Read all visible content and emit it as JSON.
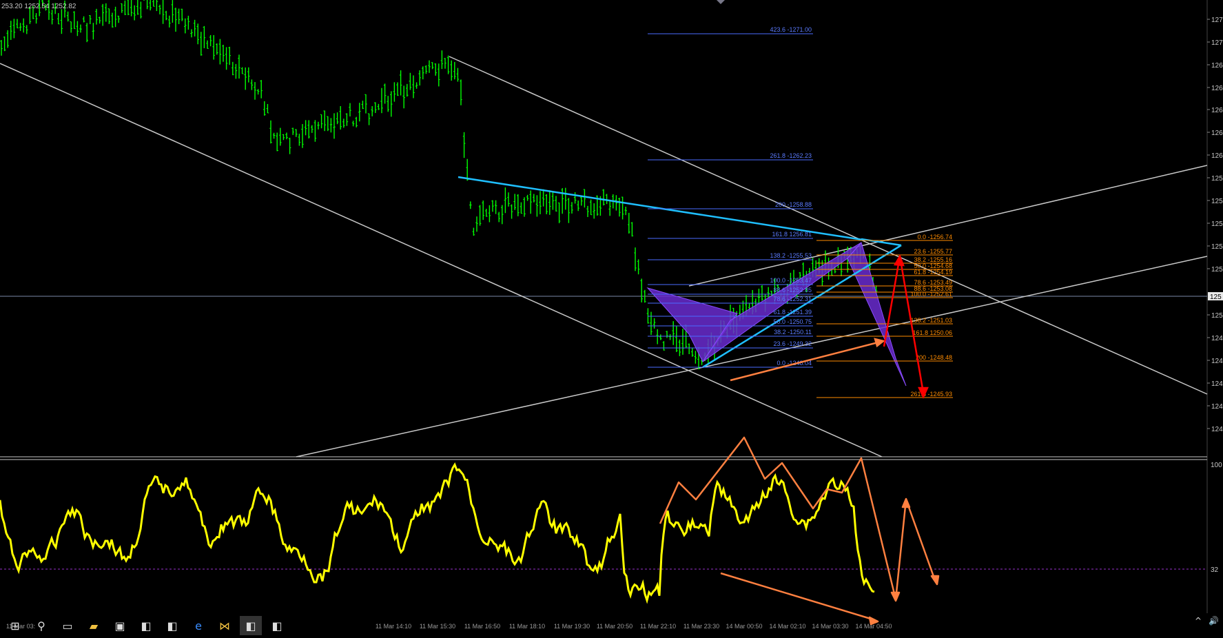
{
  "ohlc_header": "253.20 1252.54 1252.82",
  "price_axis": [
    "127",
    "127",
    "126",
    "126",
    "126",
    "126",
    "126",
    "125",
    "125",
    "125",
    "125",
    "125",
    "125",
    "124",
    "124",
    "124",
    "124",
    "124"
  ],
  "current_price_tag": "125",
  "indicator_axis": {
    "top": "100",
    "mid": "32"
  },
  "fib_blue": [
    "423.6 -1271.00",
    "261.8 -1262.23",
    "200 -1258.88",
    "161.8 1256.81",
    "138.2 -1255.53",
    "100.0 -1253.47",
    "88.6 -1252.85",
    "78.6 -1252.31",
    "61.8 -1251.39",
    "50.0 -1250.75",
    "38.2 -1250.11",
    "23.6 -1249.32",
    "0.0 -1248.04"
  ],
  "fib_orange": [
    "0.0 -1256.74",
    "23.6 -1255.77",
    "38.2 -1255.16",
    "50.0 -1254.68",
    "61.8 -1254.19",
    "78.6 -1253.49",
    "88.6 -1253.08",
    "100.0 -1252.61",
    "138.2 -1251.03",
    "161.8 1250.06",
    "200 -1248.48",
    "261.8 -1245.93"
  ],
  "time_axis": [
    "11 Mar 03:",
    "11 Mar 16:50",
    "11 Mar 18:10",
    "11 Mar 19:30",
    "11 Mar 20:50",
    "11 Mar 22:10",
    "11 Mar 23:30",
    "14 Mar 00:50",
    "14 Mar 02:10",
    "14 Mar 03:30",
    "14 Mar 04:50",
    "11 Mar 14:10",
    "11 Mar 15:30"
  ],
  "taskbar": {
    "items": [
      "start",
      "search",
      "task-view",
      "file-explorer",
      "store",
      "app-1",
      "app-2",
      "edge",
      "metatrader",
      "app-3",
      "app-4"
    ],
    "tray": {
      "chevron": "^",
      "speaker": "🔊"
    }
  },
  "colors": {
    "candles": "#00ff00",
    "trendline": "#1fbfff",
    "channel": "#c8c8c8",
    "pattern_fill": "#6a2ccf",
    "fib_blue": "#4a6bff",
    "fib_orange": "#ff8c00",
    "indicator": "#ffff00",
    "arrows_orange": "#ff8040",
    "arrows_red": "#ff0000"
  }
}
